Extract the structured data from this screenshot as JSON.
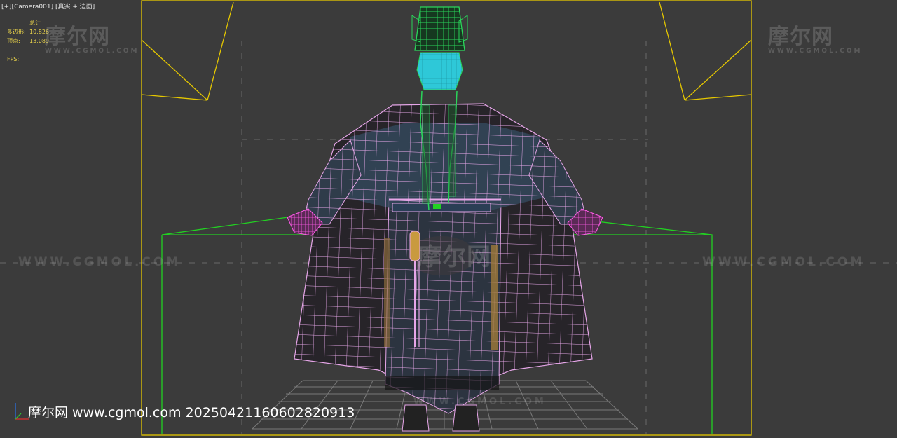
{
  "viewport": {
    "label_plus": "[+]",
    "label_camera": "[Camera001]",
    "label_shading": "[真实 + 边面]"
  },
  "stats": {
    "header": "总计",
    "polygons_label": "多边形:",
    "polygons_value": "10,826",
    "vertices_label": "顶点:",
    "vertices_value": "13,089",
    "fps_label": "FPS:"
  },
  "watermark": {
    "logo": "摩尔网",
    "logo_sub": "WWW.CGMOL.COM",
    "url": "WWW.CGMOL.COM"
  },
  "footer": {
    "text": "摩尔网 www.cgmol.com 20250421160602820913"
  },
  "colors": {
    "background": "#3b3b3b",
    "safe_frame": "#e6c800",
    "ground_box": "#22d022",
    "wire_body": "#e6a6e8",
    "wire_hat": "#2ad65a",
    "face": "#2ec8d8"
  }
}
